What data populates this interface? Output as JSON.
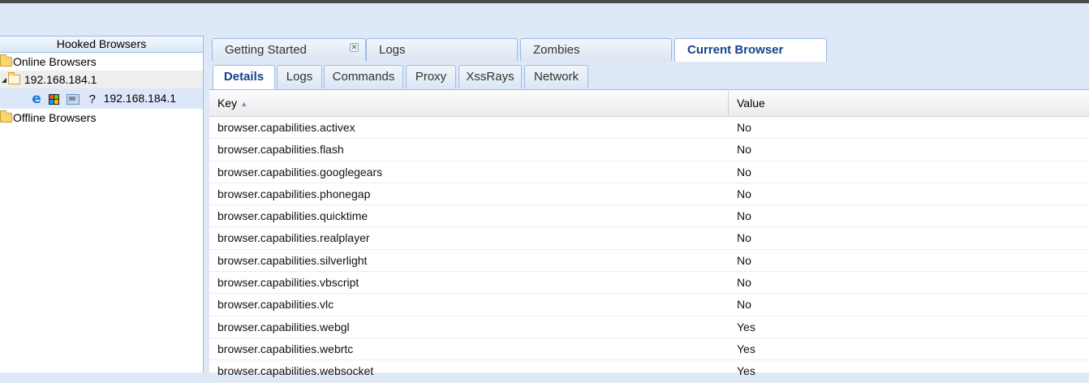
{
  "left_panel": {
    "title": "Hooked Browsers",
    "online_label": "Online Browsers",
    "host_label": "192.168.184.1",
    "browser_ip": "192.168.184.1",
    "unknown_glyph": "?",
    "offline_label": "Offline Browsers"
  },
  "tabs": [
    {
      "label": "Getting Started"
    },
    {
      "label": "Logs"
    },
    {
      "label": "Zombies"
    },
    {
      "label": "Current Browser"
    }
  ],
  "subtabs": [
    {
      "label": "Details"
    },
    {
      "label": "Logs"
    },
    {
      "label": "Commands"
    },
    {
      "label": "Proxy"
    },
    {
      "label": "XssRays"
    },
    {
      "label": "Network"
    }
  ],
  "grid": {
    "key_header": "Key",
    "value_header": "Value",
    "rows": [
      {
        "key": "browser.capabilities.activex",
        "value": "No"
      },
      {
        "key": "browser.capabilities.flash",
        "value": "No"
      },
      {
        "key": "browser.capabilities.googlegears",
        "value": "No"
      },
      {
        "key": "browser.capabilities.phonegap",
        "value": "No"
      },
      {
        "key": "browser.capabilities.quicktime",
        "value": "No"
      },
      {
        "key": "browser.capabilities.realplayer",
        "value": "No"
      },
      {
        "key": "browser.capabilities.silverlight",
        "value": "No"
      },
      {
        "key": "browser.capabilities.vbscript",
        "value": "No"
      },
      {
        "key": "browser.capabilities.vlc",
        "value": "No"
      },
      {
        "key": "browser.capabilities.webgl",
        "value": "Yes"
      },
      {
        "key": "browser.capabilities.webrtc",
        "value": "Yes"
      },
      {
        "key": "browser.capabilities.websocket",
        "value": "Yes"
      }
    ]
  },
  "colors": {
    "accent": "#15428b",
    "panel_border": "#99bbe8",
    "background": "#dfe8f6"
  }
}
